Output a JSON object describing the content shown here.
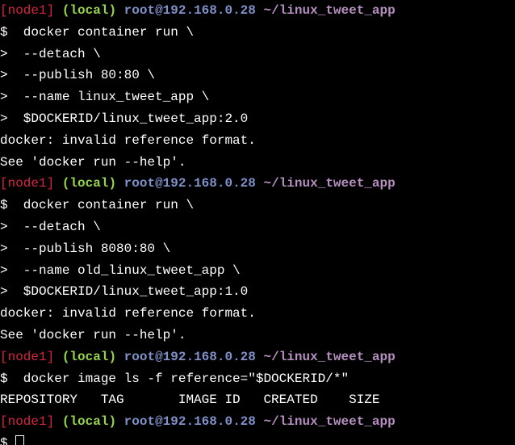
{
  "terminal": {
    "prompt": {
      "node": "[node1]",
      "local": "(local)",
      "host": "root@192.168.0.28",
      "path": "~/linux_tweet_app"
    },
    "lines": [
      {
        "type": "prompt"
      },
      {
        "type": "text",
        "text": "$  docker container run \\"
      },
      {
        "type": "text",
        "text": ">  --detach \\"
      },
      {
        "type": "text",
        "text": ">  --publish 80:80 \\"
      },
      {
        "type": "text",
        "text": ">  --name linux_tweet_app \\"
      },
      {
        "type": "text",
        "text": ">  $DOCKERID/linux_tweet_app:2.0"
      },
      {
        "type": "text",
        "text": "docker: invalid reference format."
      },
      {
        "type": "text",
        "text": "See 'docker run --help'."
      },
      {
        "type": "prompt"
      },
      {
        "type": "text",
        "text": "$  docker container run \\"
      },
      {
        "type": "text",
        "text": ">  --detach \\"
      },
      {
        "type": "text",
        "text": ">  --publish 8080:80 \\"
      },
      {
        "type": "text",
        "text": ">  --name old_linux_tweet_app \\"
      },
      {
        "type": "text",
        "text": ">  $DOCKERID/linux_tweet_app:1.0"
      },
      {
        "type": "text",
        "text": "docker: invalid reference format."
      },
      {
        "type": "text",
        "text": "See 'docker run --help'."
      },
      {
        "type": "prompt"
      },
      {
        "type": "text",
        "text": "$  docker image ls -f reference=\"$DOCKERID/*\""
      },
      {
        "type": "text",
        "text": "REPOSITORY   TAG       IMAGE ID   CREATED    SIZE"
      },
      {
        "type": "prompt"
      },
      {
        "type": "cursor",
        "text": "$ "
      }
    ],
    "colors": {
      "background": "#000000",
      "text": "#ffffff",
      "node": "#d6263f",
      "local": "#95d44a",
      "host": "#7f91c8",
      "path": "#b58fbf"
    }
  }
}
